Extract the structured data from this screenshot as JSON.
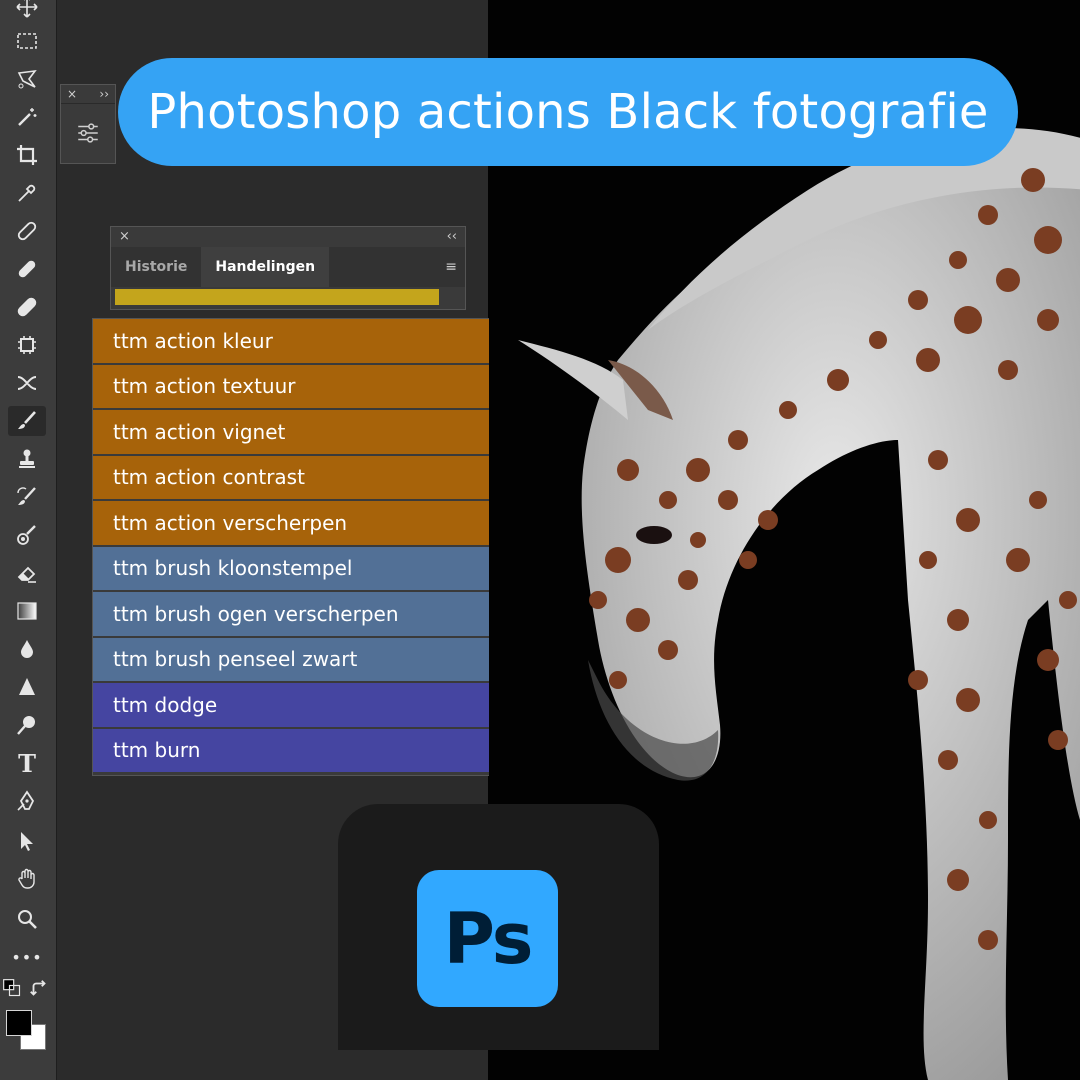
{
  "title": "Photoshop actions Black fotografie",
  "panel": {
    "close": "×",
    "collapse": "‹‹",
    "tabs": [
      {
        "label": "Historie",
        "active": false
      },
      {
        "label": "Handelingen",
        "active": true
      }
    ],
    "menu": "≡"
  },
  "mini_panel": {
    "close": "×",
    "expand": "››"
  },
  "actions": [
    {
      "label": "ttm action kleur",
      "color": "#a7630a"
    },
    {
      "label": "ttm action textuur",
      "color": "#a7630a"
    },
    {
      "label": "ttm action vignet",
      "color": "#a7630a"
    },
    {
      "label": "ttm action contrast",
      "color": "#a7630a"
    },
    {
      "label": "ttm action verscherpen",
      "color": "#a7630a"
    },
    {
      "label": "ttm brush kloonstempel",
      "color": "#527096"
    },
    {
      "label": "ttm brush ogen verscherpen",
      "color": "#527096"
    },
    {
      "label": "ttm brush penseel zwart",
      "color": "#527096"
    },
    {
      "label": "ttm dodge",
      "color": "#4545a1"
    },
    {
      "label": "ttm burn",
      "color": "#4545a1"
    }
  ],
  "logo": {
    "text": "Ps",
    "color": "#31a8ff"
  },
  "toolbar": {
    "tools": [
      "move-icon",
      "marquee-icon",
      "lasso-icon",
      "magic-wand-icon",
      "crop-icon",
      "eyedropper-icon",
      "spot-healing-icon",
      "healing-brush-icon",
      "patch-icon",
      "content-aware-icon",
      "red-eye-icon",
      "brush-icon",
      "clone-stamp-icon",
      "history-brush-icon",
      "mixer-brush-icon",
      "eraser-icon",
      "gradient-icon",
      "blur-icon",
      "sharpen-icon",
      "dodge-icon",
      "type-icon",
      "pen-icon",
      "path-selection-icon",
      "hand-icon",
      "zoom-icon",
      "more-icon"
    ],
    "type_glyph": "T",
    "more_glyph": "•••"
  }
}
